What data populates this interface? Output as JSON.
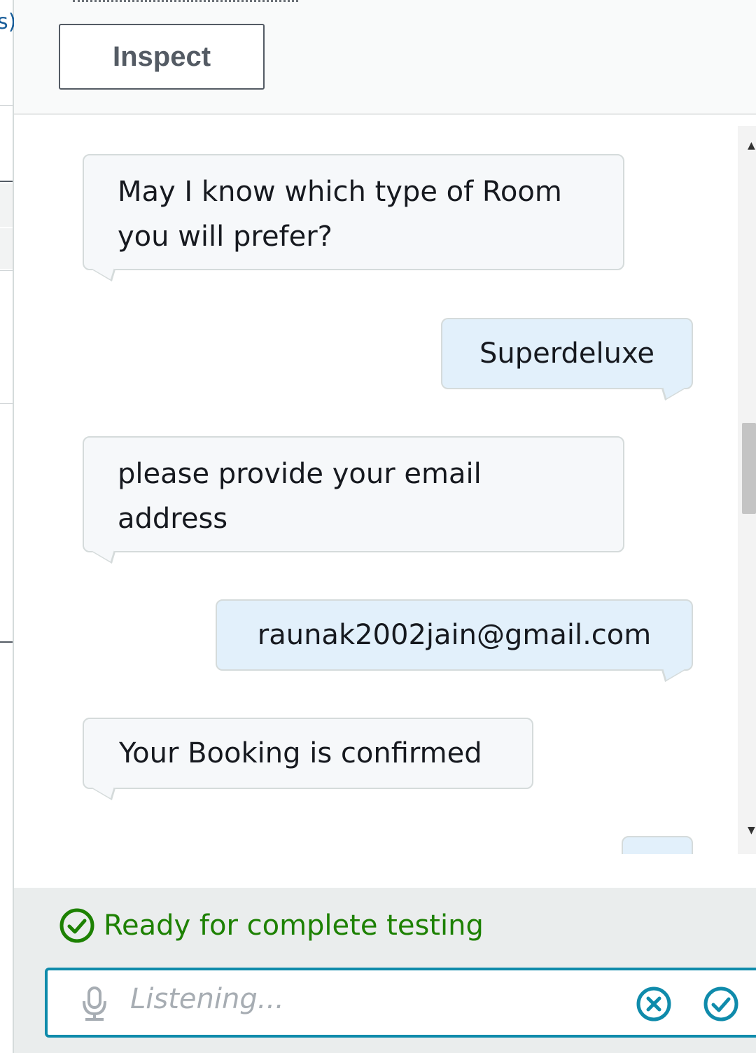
{
  "left_pane": {
    "fragment": "s)"
  },
  "header": {
    "inspect_label": "Inspect"
  },
  "messages": [
    {
      "from": "bot",
      "text": "May I know which type of Room you will prefer?"
    },
    {
      "from": "user",
      "text": "Superdeluxe"
    },
    {
      "from": "bot",
      "text": "please provide your email address"
    },
    {
      "from": "user",
      "text": "raunak2002jain@gmail.com"
    },
    {
      "from": "bot",
      "text": "Your Booking is confirmed"
    }
  ],
  "status": {
    "text": "Ready for complete testing",
    "icon": "check-circle-icon",
    "color": "#1d8102"
  },
  "input": {
    "placeholder": "Listening...",
    "mic_icon": "microphone-icon",
    "clear_icon": "close-circle-icon",
    "confirm_icon": "check-circle-icon",
    "accent": "#0f8bab"
  }
}
